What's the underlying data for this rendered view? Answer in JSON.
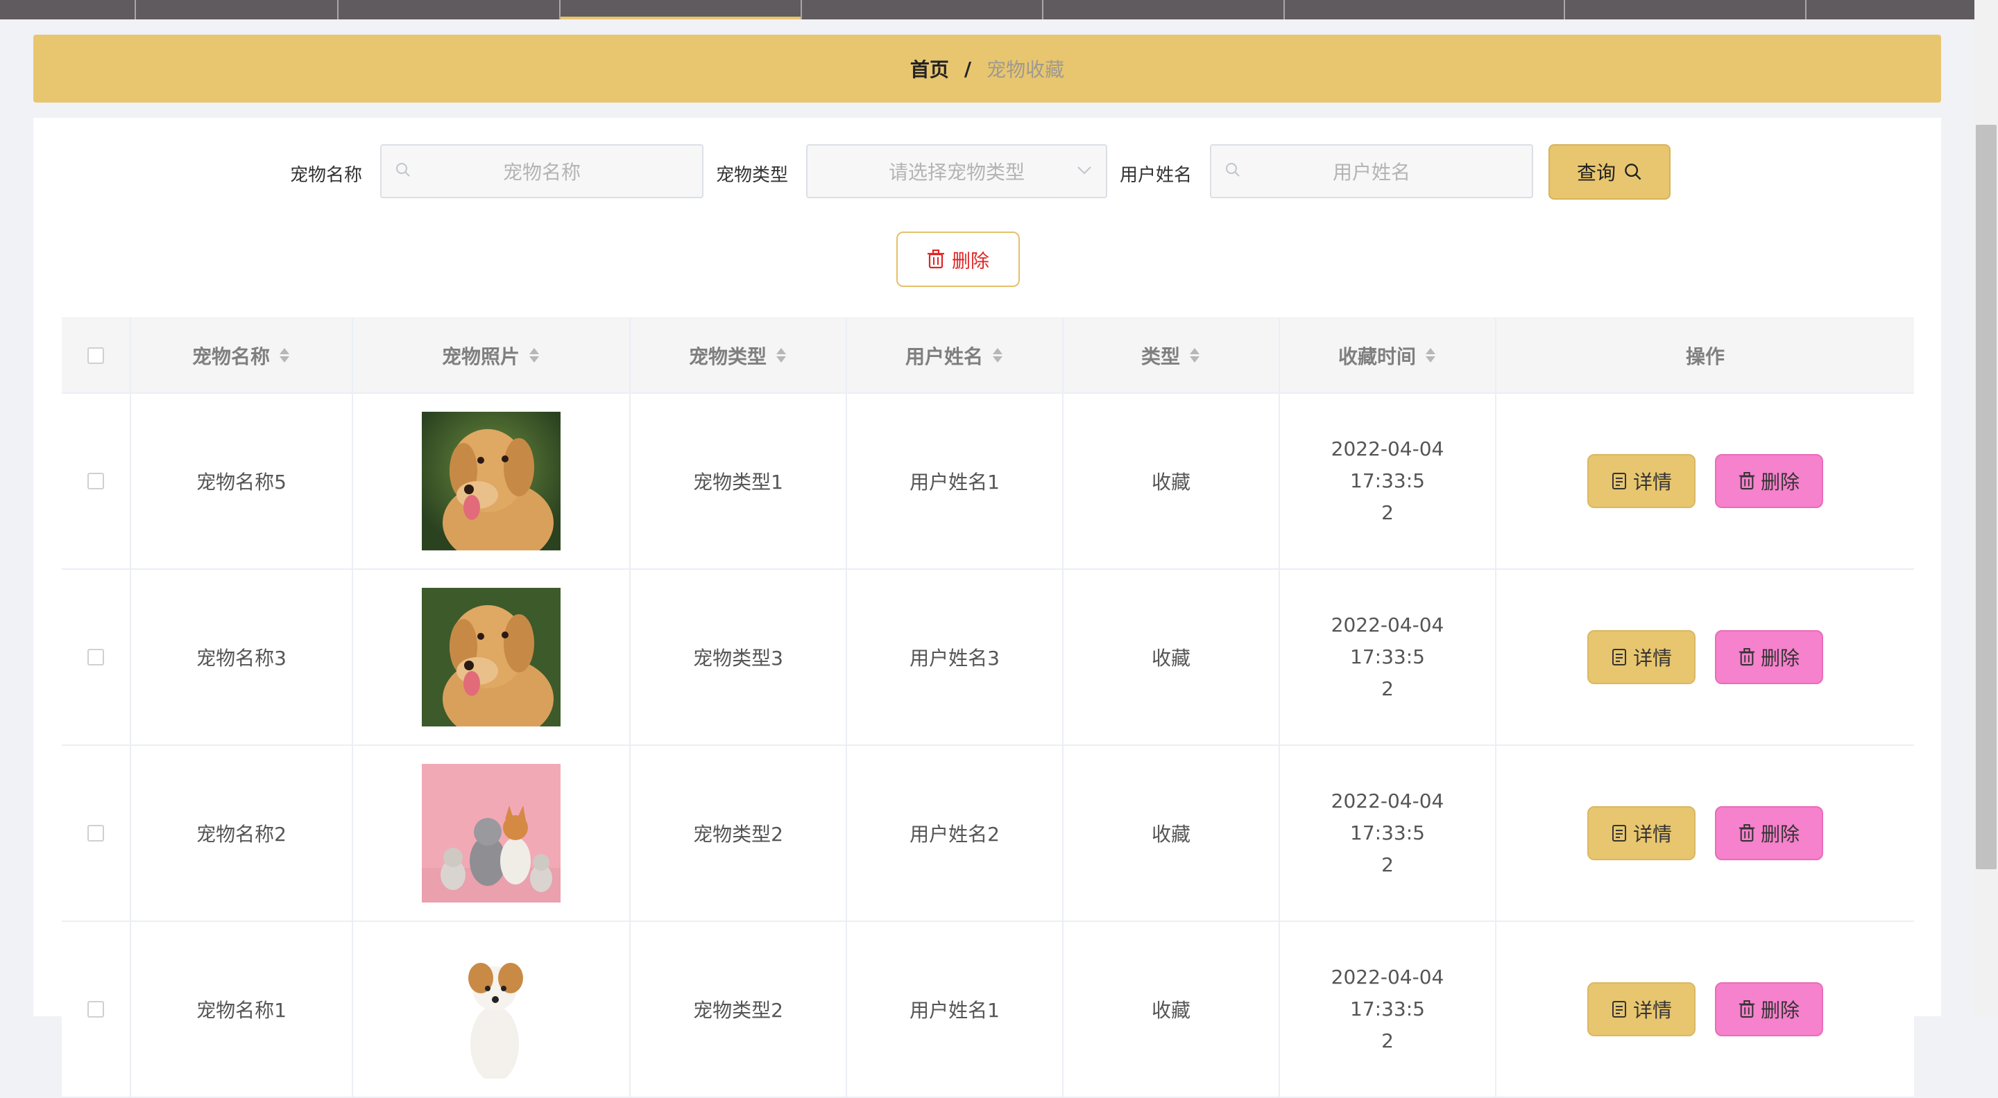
{
  "nav": {
    "colors": {
      "bar": "#5f5b5e",
      "active_underline": "#e7c56d"
    }
  },
  "breadcrumb": {
    "home": "首页",
    "separator": "/",
    "current": "宠物收藏"
  },
  "search": {
    "pet_name_label": "宠物名称",
    "pet_name_placeholder": "宠物名称",
    "pet_type_label": "宠物类型",
    "pet_type_placeholder": "请选择宠物类型",
    "user_name_label": "用户姓名",
    "user_name_placeholder": "用户姓名",
    "query_label": "查询"
  },
  "toolbar": {
    "delete_label": "删除"
  },
  "table": {
    "headers": {
      "pet_name": "宠物名称",
      "pet_photo": "宠物照片",
      "pet_type": "宠物类型",
      "user_name": "用户姓名",
      "type": "类型",
      "fav_time": "收藏时间",
      "actions": "操作"
    },
    "rows": [
      {
        "pet_name": "宠物名称5",
        "photo": "golden-retriever",
        "pet_type": "宠物类型1",
        "user_name": "用户姓名1",
        "type": "收藏",
        "time_line1": "2022-04-04 17:33:5",
        "time_line2": "2"
      },
      {
        "pet_name": "宠物名称3",
        "photo": "golden-retriever",
        "pet_type": "宠物类型3",
        "user_name": "用户姓名3",
        "type": "收藏",
        "time_line1": "2022-04-04 17:33:5",
        "time_line2": "2"
      },
      {
        "pet_name": "宠物名称2",
        "photo": "pets-on-pink",
        "pet_type": "宠物类型2",
        "user_name": "用户姓名2",
        "type": "收藏",
        "time_line1": "2022-04-04 17:33:5",
        "time_line2": "2"
      },
      {
        "pet_name": "宠物名称1",
        "photo": "small-dog",
        "pet_type": "宠物类型2",
        "user_name": "用户姓名1",
        "type": "收藏",
        "time_line1": "2022-04-04 17:33:5",
        "time_line2": "2"
      }
    ],
    "detail_label": "详情",
    "delete_label": "删除"
  },
  "colors": {
    "accent": "#e8c66f",
    "danger": "#e02424",
    "pink_button": "#f681cc"
  }
}
